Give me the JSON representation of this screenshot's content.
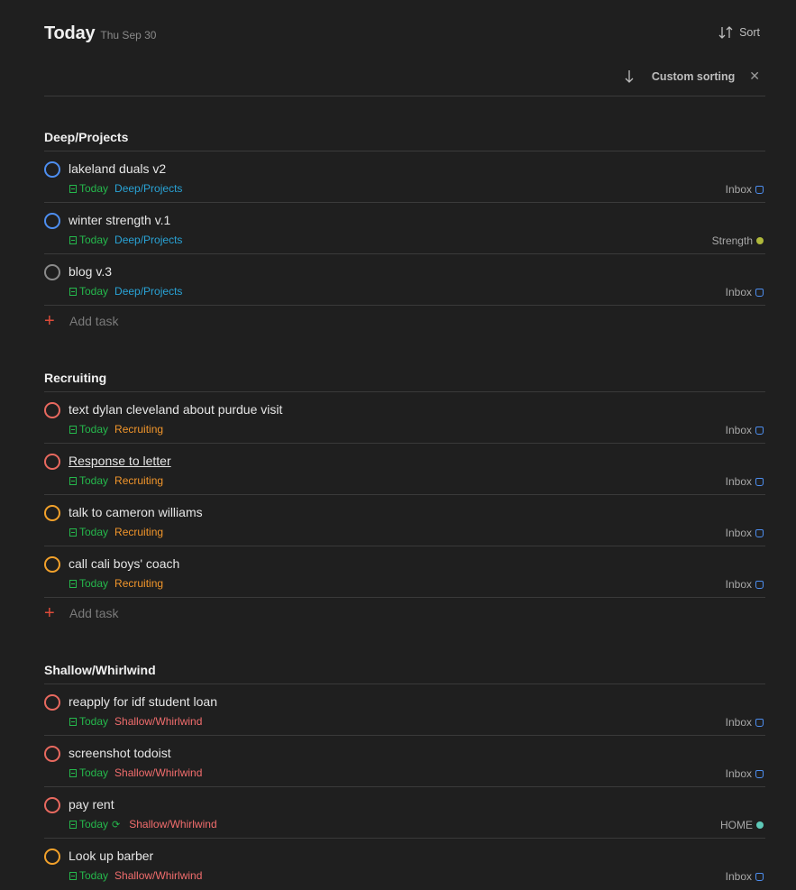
{
  "header": {
    "title": "Today",
    "date": "Thu Sep 30",
    "sort_label": "Sort",
    "filter_label": "Custom sorting"
  },
  "colors": {
    "blue": "#4d8ef0",
    "gray": "#8a8a8a",
    "red": "#e8695f",
    "orange": "#f2a12b",
    "green": "#25b84c"
  },
  "sections": [
    {
      "title": "Deep/Projects",
      "add_label": "Add task",
      "tasks": [
        {
          "name": "lakeland duals v2",
          "priority": "blue",
          "due": "Today",
          "section_label": "Deep/Projects",
          "project": "Inbox"
        },
        {
          "name": "winter strength v.1",
          "priority": "blue",
          "due": "Today",
          "section_label": "Deep/Projects",
          "project": "Strength"
        },
        {
          "name": "blog v.3",
          "priority": "gray",
          "due": "Today",
          "section_label": "Deep/Projects",
          "project": "Inbox"
        }
      ]
    },
    {
      "title": "Recruiting",
      "add_label": "Add task",
      "tasks": [
        {
          "name": "text dylan cleveland about purdue visit",
          "priority": "red",
          "due": "Today",
          "section_label": "Recruiting",
          "project": "Inbox"
        },
        {
          "name": "Response to letter",
          "priority": "red",
          "due": "Today",
          "section_label": "Recruiting",
          "project": "Inbox"
        },
        {
          "name": "talk to cameron williams",
          "priority": "orange",
          "due": "Today",
          "section_label": "Recruiting",
          "project": "Inbox"
        },
        {
          "name": "call cali boys' coach",
          "priority": "orange",
          "due": "Today",
          "section_label": "Recruiting",
          "project": "Inbox"
        }
      ]
    },
    {
      "title": "Shallow/Whirlwind",
      "tasks": [
        {
          "name": "reapply for idf student loan",
          "priority": "red",
          "due": "Today",
          "section_label": "Shallow/Whirlwind",
          "project": "Inbox"
        },
        {
          "name": "screenshot todoist",
          "priority": "red",
          "due": "Today",
          "section_label": "Shallow/Whirlwind",
          "project": "Inbox"
        },
        {
          "name": "pay rent",
          "priority": "red",
          "due": "Today",
          "section_label": "Shallow/Whirlwind",
          "project": "HOME"
        },
        {
          "name": "Look up barber",
          "priority": "orange",
          "due": "Today",
          "section_label": "Shallow/Whirlwind",
          "project": "Inbox"
        }
      ]
    }
  ]
}
